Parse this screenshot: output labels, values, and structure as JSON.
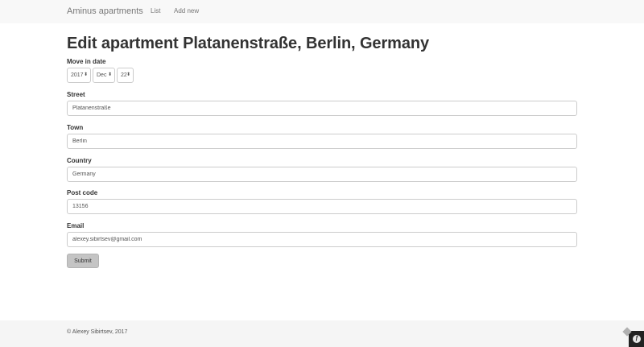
{
  "navbar": {
    "brand": "Aminus apartments",
    "links": [
      {
        "label": "List"
      },
      {
        "label": "Add new"
      }
    ]
  },
  "page": {
    "title": "Edit apartment Platanenstraße, Berlin, Germany"
  },
  "form": {
    "move_in_date": {
      "label": "Move in date",
      "year": "2017",
      "month": "Dec",
      "day": "22"
    },
    "street": {
      "label": "Street",
      "value": "Platanenstraße"
    },
    "town": {
      "label": "Town",
      "value": "Berlin"
    },
    "country": {
      "label": "Country",
      "value": "Germany"
    },
    "post_code": {
      "label": "Post code",
      "value": "13156"
    },
    "email": {
      "label": "Email",
      "value": "alexey.sibirtsev@gmail.com"
    },
    "submit_label": "Submit"
  },
  "footer": {
    "text": "© Alexey Sibirtsev, 2017"
  },
  "icons": {
    "debug_toolbar": "symfony-logo-icon"
  },
  "colors": {
    "navbar_bg": "#f8f8f8",
    "footer_bg": "#f5f5f5",
    "submit_bg": "#c4c4c4"
  }
}
